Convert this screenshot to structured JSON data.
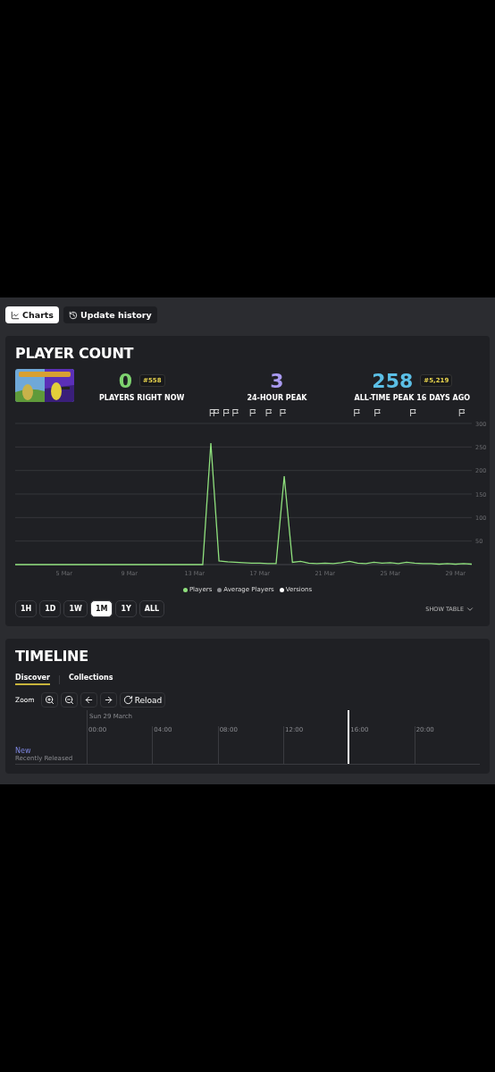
{
  "view_tabs": [
    {
      "label": "Charts",
      "selected": true
    },
    {
      "label": "Update history",
      "selected": false
    }
  ],
  "player_count": {
    "title": "PLAYER COUNT",
    "stats": [
      {
        "value": "0",
        "rank": "#558",
        "label": "PLAYERS RIGHT NOW",
        "color": "#7ed36f"
      },
      {
        "value": "3",
        "label": "24-HOUR PEAK",
        "color": "#a99af0"
      },
      {
        "value": "258",
        "rank": "#5,219",
        "label": "ALL-TIME PEAK 16 DAYS AGO",
        "color": "#5bbfe6"
      }
    ],
    "chart_data": {
      "type": "line",
      "ylim": [
        0,
        300
      ],
      "grid": true,
      "yticks": [
        50,
        100,
        150,
        200,
        250,
        300
      ],
      "categories": [
        null,
        null,
        null,
        null,
        null,
        null,
        "5 Mar",
        null,
        null,
        null,
        null,
        null,
        null,
        null,
        "9 Mar",
        null,
        null,
        null,
        null,
        null,
        null,
        null,
        "13 Mar",
        null,
        null,
        null,
        null,
        null,
        null,
        null,
        "17 Mar",
        null,
        null,
        null,
        null,
        null,
        null,
        null,
        "21 Mar",
        null,
        null,
        null,
        null,
        null,
        null,
        null,
        "25 Mar",
        null,
        null,
        null,
        null,
        null,
        null,
        null,
        "29 Mar",
        null,
        null
      ],
      "series": [
        {
          "name": "Players",
          "color": "#8fe07d",
          "values": [
            0,
            0,
            0,
            0,
            0,
            0,
            0,
            0,
            0,
            0,
            0,
            0,
            0,
            0,
            0,
            0,
            0,
            0,
            0,
            0,
            0,
            0,
            0,
            0,
            258,
            8,
            6,
            5,
            4,
            3,
            3,
            2,
            2,
            188,
            5,
            7,
            3,
            2,
            3,
            2,
            4,
            7,
            3,
            2,
            5,
            3,
            4,
            2,
            5,
            3,
            2,
            2,
            1,
            2,
            1,
            2,
            1
          ]
        }
      ]
    },
    "legend": [
      {
        "label": "Average Players",
        "color": "#8a8b8f"
      },
      {
        "label": "Versions",
        "color": "#ffffff"
      }
    ],
    "ranges": [
      {
        "label": "1H",
        "selected": false
      },
      {
        "label": "1D",
        "selected": false
      },
      {
        "label": "1W",
        "selected": false
      },
      {
        "label": "1M",
        "selected": true
      },
      {
        "label": "1Y",
        "selected": false
      },
      {
        "label": "ALL",
        "selected": false
      }
    ],
    "show_table": "SHOW TABLE"
  },
  "timeline": {
    "title": "TIMELINE",
    "tabs": [
      {
        "label": "Discover",
        "selected": true
      },
      {
        "label": "Collections",
        "selected": false
      }
    ],
    "zoom_label": "Zoom",
    "controls": [
      {
        "kind": "zoom-in"
      },
      {
        "kind": "zoom-out"
      },
      {
        "kind": "back"
      },
      {
        "kind": "forward"
      },
      {
        "kind": "reload",
        "label": "Reload"
      }
    ],
    "date": "Sun 29 March",
    "hours": [
      "00:00",
      "04:00",
      "08:00",
      "12:00",
      "16:00",
      "20:00"
    ],
    "rows": [
      {
        "name": "New",
        "subtitle": "Recently Released"
      }
    ]
  }
}
